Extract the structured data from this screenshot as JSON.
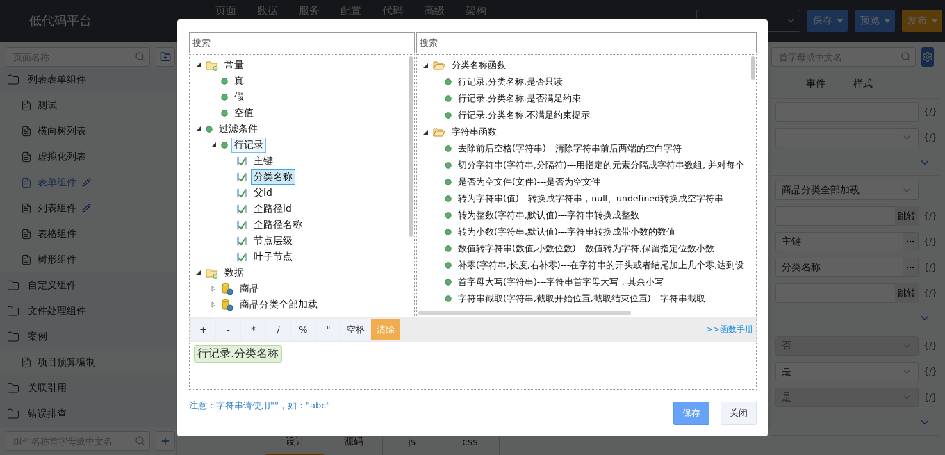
{
  "header": {
    "title": "低代码平台",
    "nav": [
      {
        "label": "页面"
      },
      {
        "label": "数据"
      },
      {
        "label": "服务"
      },
      {
        "label": "配置"
      },
      {
        "label": "代码"
      },
      {
        "label": "高级"
      },
      {
        "label": "架构"
      }
    ],
    "actions": [
      {
        "label": "保存",
        "kind": "primary"
      },
      {
        "label": "预览",
        "kind": "primary"
      },
      {
        "label": "发布",
        "kind": "warning"
      }
    ]
  },
  "sidebar": {
    "search": {
      "placeholder": "页面名称"
    },
    "tree": [
      {
        "label": "列表表单组件",
        "children": [
          {
            "label": "测试",
            "selected": false,
            "editing": false
          },
          {
            "label": "横向树列表",
            "selected": false,
            "editing": false
          },
          {
            "label": "虚拟化列表",
            "selected": false,
            "editing": false
          },
          {
            "label": "表单组件",
            "selected": true,
            "editing": true
          },
          {
            "label": "列表组件",
            "selected": false,
            "editing": true
          },
          {
            "label": "表格组件",
            "selected": false,
            "editing": false
          },
          {
            "label": "树形组件",
            "selected": false,
            "editing": false
          }
        ]
      },
      {
        "label": "自定义组件"
      },
      {
        "label": "文件处理组件"
      },
      {
        "label": "案例",
        "children": [
          {
            "label": "项目预算编制",
            "selected": false,
            "editing": false
          }
        ]
      },
      {
        "label": "关联引用"
      },
      {
        "label": "错误排查"
      }
    ],
    "component_search": {
      "placeholder": "组件名称首字母或中文名"
    }
  },
  "editor_tabs": [
    {
      "label": "设计",
      "selected": true
    },
    {
      "label": "源码",
      "selected": false
    },
    {
      "label": "js",
      "selected": false
    },
    {
      "label": "css",
      "selected": false
    }
  ],
  "properties": {
    "search": {
      "placeholder": "首字母或中文名"
    },
    "tabs": [
      {
        "label": "事件",
        "selected": false
      },
      {
        "label": "样式",
        "selected": false
      }
    ],
    "fields": [
      {
        "kind": "text",
        "binding": "{/}"
      },
      {
        "kind": "select",
        "binding": "{/}"
      },
      {
        "kind": "section"
      },
      {
        "kind": "select",
        "value": "商品分类全部加载",
        "disabled": false
      },
      {
        "kind": "jump",
        "button": "跳转",
        "binding": "{/}"
      },
      {
        "kind": "picker",
        "value": "主键",
        "binding": "{/}"
      },
      {
        "kind": "picker",
        "value": "分类名称",
        "binding": "{/}"
      },
      {
        "kind": "jump",
        "button": "跳转",
        "binding": "{/}"
      },
      {
        "kind": "section"
      },
      {
        "kind": "select",
        "value": "否",
        "disabled": true,
        "binding": "{/}"
      },
      {
        "kind": "select",
        "value": "是",
        "disabled": false,
        "binding": "{/}"
      },
      {
        "kind": "select",
        "value": "是",
        "disabled": true,
        "binding": "{/}"
      },
      {
        "kind": "section"
      }
    ]
  },
  "dialog": {
    "left_search": {
      "placeholder": "搜索"
    },
    "right_search": {
      "placeholder": "搜索"
    },
    "variables": [
      {
        "label": "常量",
        "kind": "folder",
        "expanded": true,
        "selected": false,
        "outlined": false,
        "children": [
          {
            "label": "真",
            "kind": "value",
            "selected": false,
            "outlined": false
          },
          {
            "label": "假",
            "kind": "value",
            "selected": false,
            "outlined": false
          },
          {
            "label": "空值",
            "kind": "value",
            "selected": false,
            "outlined": false
          }
        ]
      },
      {
        "label": "过滤条件",
        "kind": "value",
        "expanded": true,
        "selected": false,
        "outlined": false,
        "children": [
          {
            "label": "行记录",
            "kind": "value",
            "expanded": true,
            "selected": false,
            "outlined": true,
            "children": [
              {
                "label": "主键",
                "kind": "field",
                "selected": false,
                "outlined": false
              },
              {
                "label": "分类名称",
                "kind": "field",
                "selected": true,
                "outlined": false
              },
              {
                "label": "父id",
                "kind": "field",
                "selected": false,
                "outlined": false
              },
              {
                "label": "全路径id",
                "kind": "field",
                "selected": false,
                "outlined": false
              },
              {
                "label": "全路径名称",
                "kind": "field",
                "selected": false,
                "outlined": false
              },
              {
                "label": "节点层级",
                "kind": "field",
                "selected": false,
                "outlined": false
              },
              {
                "label": "叶子节点",
                "kind": "field",
                "selected": false,
                "outlined": false
              }
            ]
          }
        ]
      },
      {
        "label": "数据",
        "kind": "folder",
        "expanded": true,
        "selected": false,
        "outlined": false,
        "children": [
          {
            "label": "商品",
            "kind": "dataset",
            "expanded": false,
            "selected": false,
            "outlined": false
          },
          {
            "label": "商品分类全部加载",
            "kind": "dataset",
            "expanded": false,
            "selected": false,
            "outlined": false
          }
        ]
      }
    ],
    "functions": [
      {
        "label": "分类名称函数",
        "expanded": true,
        "children": [
          {
            "label": "行记录.分类名称.是否只读"
          },
          {
            "label": "行记录.分类名称.是否满足约束"
          },
          {
            "label": "行记录.分类名称.不满足约束提示"
          }
        ]
      },
      {
        "label": "字符串函数",
        "expanded": true,
        "children": [
          {
            "label": "去除前后空格(字符串)---清除字符串前后两端的空白字符"
          },
          {
            "label": "切分字符串(字符串,分隔符)---用指定的元素分隔成字符串数组, 并对每个"
          },
          {
            "label": "是否为空文件(文件)---是否为空文件"
          },
          {
            "label": "转为字符串(值)---转换成字符串，null、undefined转换成空字符串"
          },
          {
            "label": "转为整数(字符串,默认值)---字符串转换成整数"
          },
          {
            "label": "转为小数(字符串,默认值)---字符串转换成带小数的数值"
          },
          {
            "label": "数值转字符串(数值,小数位数)---数值转为字符,保留指定位数小数"
          },
          {
            "label": "补零(字符串,长度,右补零)---在字符串的开头或者结尾加上几个零,达到设"
          },
          {
            "label": "首字母大写(字符串)---字符串首字母大写，其余小写"
          },
          {
            "label": "字符串截取(字符串,截取开始位置,截取结束位置)---字符串截取"
          }
        ]
      }
    ],
    "operators": [
      {
        "label": "+",
        "kind": "operator"
      },
      {
        "label": "-",
        "kind": "operator"
      },
      {
        "label": "*",
        "kind": "operator"
      },
      {
        "label": "/",
        "kind": "operator"
      },
      {
        "label": "%",
        "kind": "operator"
      },
      {
        "label": "\"",
        "kind": "operator"
      },
      {
        "label": "空格",
        "kind": "operator"
      },
      {
        "label": "清除",
        "kind": "clear"
      }
    ],
    "manual_link": ">>函数手册",
    "expression": [
      {
        "label": "行记录.分类名称"
      }
    ],
    "note": "注意：字符串请使用\"\"，如：\"abc\"",
    "buttons": [
      {
        "label": "保存",
        "kind": "primary"
      },
      {
        "label": "关闭",
        "kind": "default"
      }
    ]
  }
}
